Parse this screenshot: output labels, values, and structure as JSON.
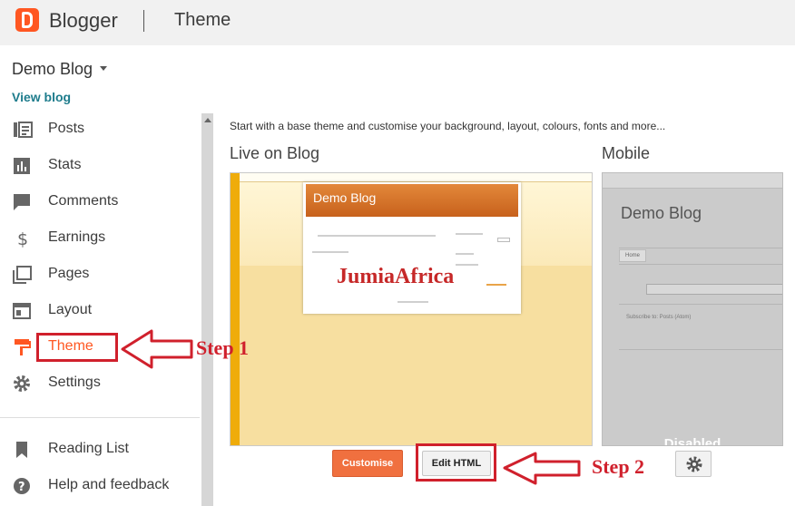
{
  "header": {
    "app_name": "Blogger",
    "page_title": "Theme"
  },
  "sidebar": {
    "blog_name": "Demo Blog",
    "view_blog": "View blog",
    "items": [
      {
        "label": "Posts",
        "icon": "posts-icon"
      },
      {
        "label": "Stats",
        "icon": "stats-icon"
      },
      {
        "label": "Comments",
        "icon": "comments-icon"
      },
      {
        "label": "Earnings",
        "icon": "dollar-icon"
      },
      {
        "label": "Pages",
        "icon": "pages-icon"
      },
      {
        "label": "Layout",
        "icon": "layout-icon"
      },
      {
        "label": "Theme",
        "icon": "paint-roller-icon",
        "active": true
      },
      {
        "label": "Settings",
        "icon": "gear-icon"
      }
    ],
    "secondary_items": [
      {
        "label": "Reading List",
        "icon": "bookmark-icon"
      },
      {
        "label": "Help and feedback",
        "icon": "help-icon"
      }
    ]
  },
  "main": {
    "intro": "Start with a base theme and customise your background, layout, colours, fonts and more...",
    "live_label": "Live on Blog",
    "mobile_label": "Mobile",
    "live_preview": {
      "blog_name": "Demo Blog"
    },
    "mobile_preview": {
      "blog_name": "Demo Blog",
      "tab": "Home",
      "subscribe": "Subscribe to: Posts (Atom)",
      "status": "Disabled"
    },
    "customise_button": "Customise",
    "edit_html_button": "Edit HTML"
  },
  "watermark": "JumiaAfrica",
  "annotations": {
    "step1": "Step 1",
    "step2": "Step 2"
  },
  "colors": {
    "accent": "#ff5722",
    "annotation": "#d0202c",
    "link": "#1e7c8c"
  }
}
